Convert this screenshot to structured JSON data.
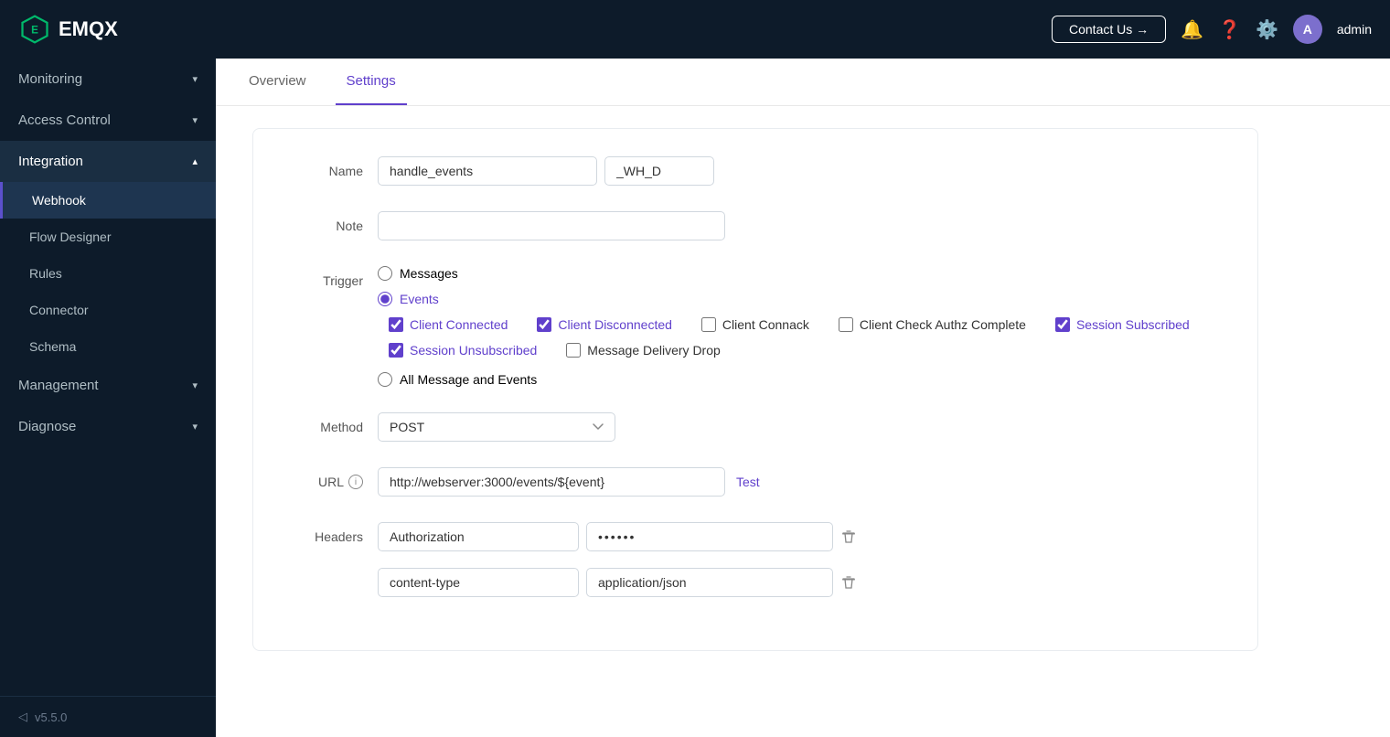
{
  "topbar": {
    "logo_text": "EMQX",
    "contact_btn": "Contact Us →",
    "admin_label": "admin"
  },
  "sidebar": {
    "items": [
      {
        "label": "Monitoring",
        "expandable": true,
        "expanded": false
      },
      {
        "label": "Access Control",
        "expandable": true,
        "expanded": false
      },
      {
        "label": "Integration",
        "expandable": true,
        "expanded": true
      },
      {
        "label": "Webhook",
        "sub": true,
        "active": true
      },
      {
        "label": "Flow Designer",
        "sub": true
      },
      {
        "label": "Rules",
        "sub": true
      },
      {
        "label": "Connector",
        "sub": true
      },
      {
        "label": "Schema",
        "sub": true
      },
      {
        "label": "Management",
        "expandable": true,
        "expanded": false
      },
      {
        "label": "Diagnose",
        "expandable": true,
        "expanded": false
      }
    ],
    "footer_icon": "◁",
    "version": "v5.5.0"
  },
  "tabs": [
    {
      "label": "Overview",
      "active": false
    },
    {
      "label": "Settings",
      "active": true
    }
  ],
  "form": {
    "name_label": "Name",
    "name_value": "handle_events",
    "name_suffix": "_WH_D",
    "note_label": "Note",
    "note_placeholder": "",
    "trigger_label": "Trigger",
    "radio_messages": "Messages",
    "radio_events": "Events",
    "checkbox_client_connected": "Client Connected",
    "checkbox_client_disconnected": "Client Disconnected",
    "checkbox_client_connack": "Client Connack",
    "checkbox_client_check_authz": "Client Check Authz Complete",
    "checkbox_session_subscribed": "Session Subscribed",
    "checkbox_session_unsubscribed": "Session Unsubscribed",
    "checkbox_message_delivery_drop": "Message Delivery Drop",
    "radio_all_message_events": "All Message and Events",
    "method_label": "Method",
    "method_value": "POST",
    "url_label": "URL",
    "url_value": "http://webserver:3000/events/${event}",
    "test_btn": "Test",
    "headers_label": "Headers",
    "header1_key": "Authorization",
    "header1_val": "••••••",
    "header2_key": "content-type",
    "header2_val": "application/json"
  }
}
